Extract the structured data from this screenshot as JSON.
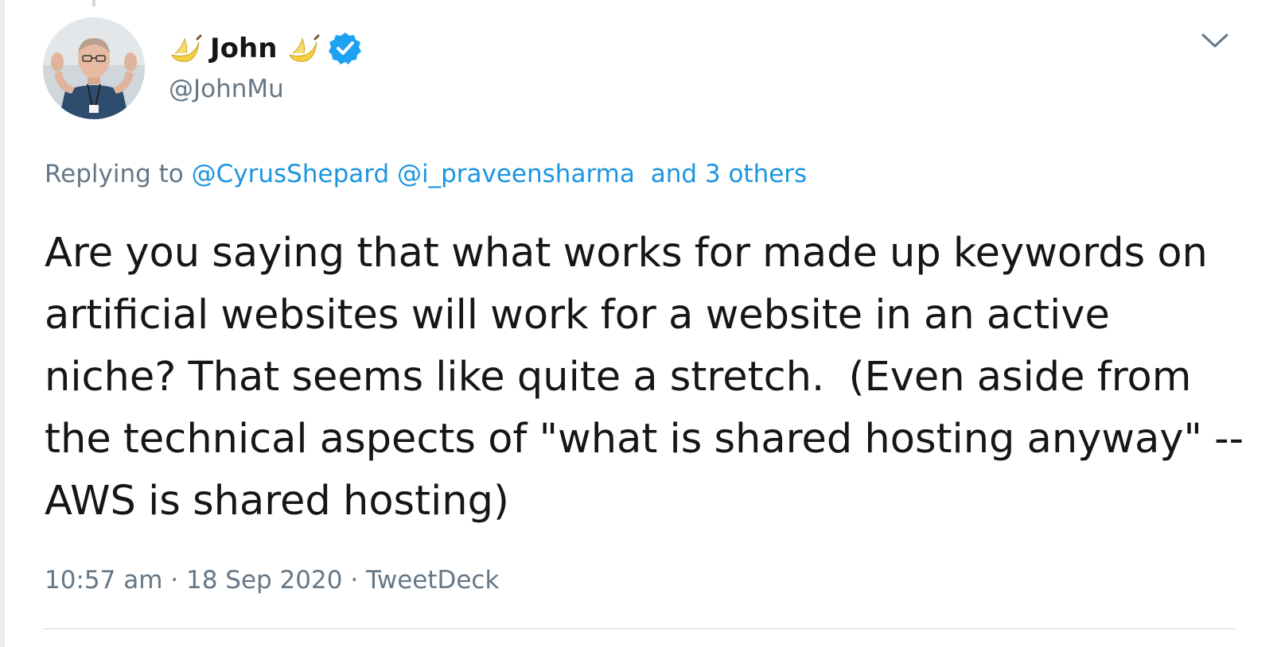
{
  "tweet": {
    "author": {
      "display_name": "John",
      "name_emoji_left": "banana-emoji",
      "name_emoji_right": "banana-emoji",
      "verified_icon": "verified-badge-icon",
      "handle": "@JohnMu",
      "avatar": "avatar-photo"
    },
    "menu_icon": "chevron-down-icon",
    "replying_to": {
      "prefix": "Replying to",
      "mentions": [
        "@CyrusShepard",
        "@i_praveensharma"
      ],
      "others": "and 3 others"
    },
    "text": "Are you saying that what works for made up keywords on artificial websites will work for a website in an active niche? That seems like quite a stretch.  (Even aside from the technical aspects of \"what is shared hosting anyway\" -- AWS is shared hosting)",
    "meta": {
      "time": "10:57 am",
      "date": "18 Sep 2020",
      "source": "TweetDeck",
      "separator": "·"
    }
  },
  "colors": {
    "text_primary": "#14171a",
    "text_secondary": "#657786",
    "link": "#1b95e0",
    "verified": "#1da1f2",
    "divider": "#e6ecf0"
  }
}
